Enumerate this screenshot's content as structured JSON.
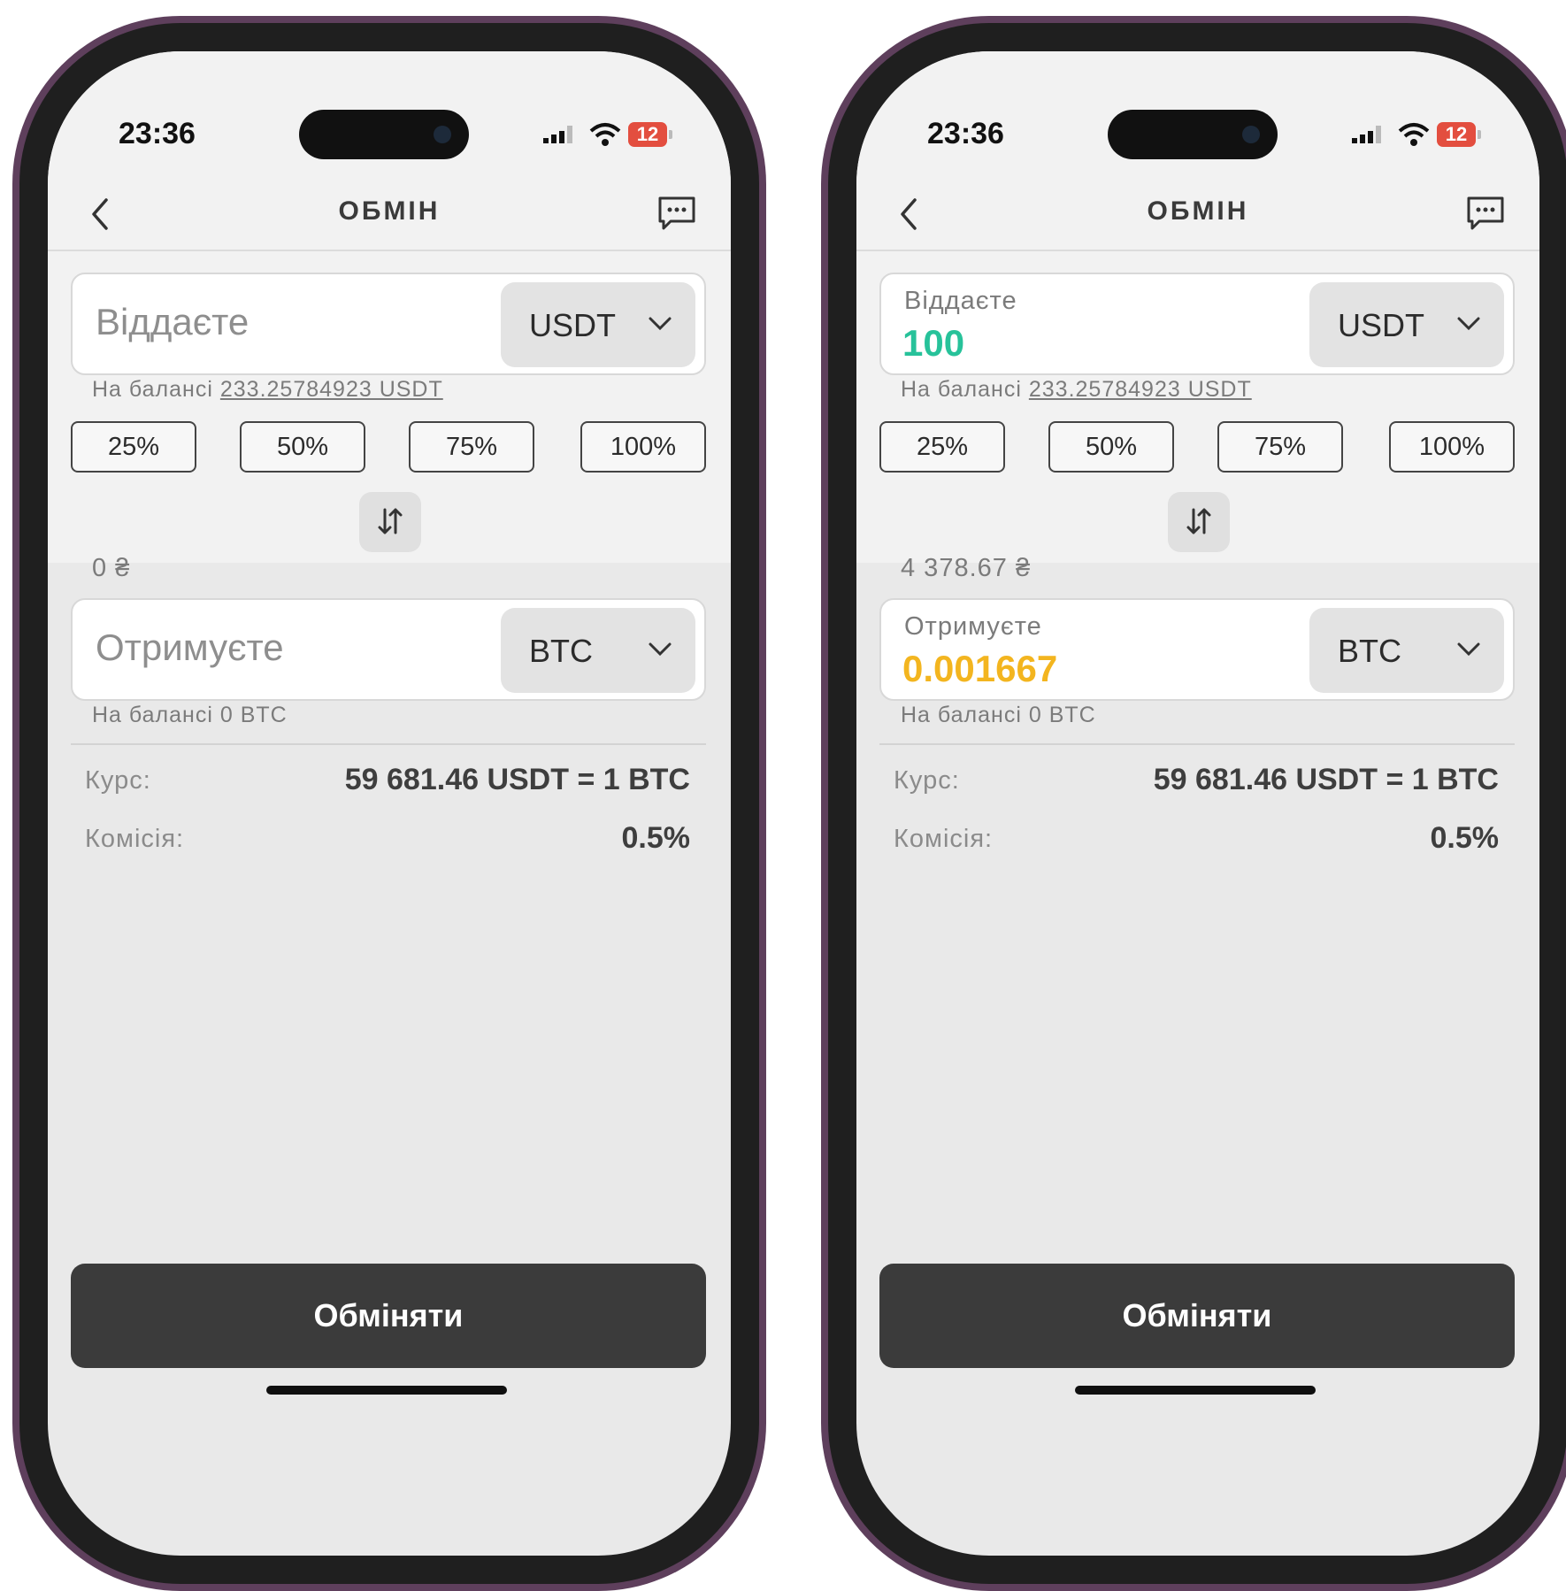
{
  "screens": [
    {
      "status": {
        "time": "23:36",
        "battery": "12"
      },
      "header": {
        "title": "ОБМІН"
      },
      "give": {
        "placeholder": "Віддаєте",
        "label": "",
        "value": "",
        "currency": "USDT",
        "balance_prefix": "На балансі",
        "balance_value": "233.25784923 USDT"
      },
      "percent_buttons": [
        "25%",
        "50%",
        "75%",
        "100%"
      ],
      "fiat_value": "0 ₴",
      "receive": {
        "placeholder": "Отримуєте",
        "label": "",
        "value": "",
        "currency": "BTC",
        "balance_text": "На балансі 0 BTC"
      },
      "rate": {
        "label": "Курс:",
        "value": "59 681.46 USDT = 1 BTC"
      },
      "fee": {
        "label": "Комісія:",
        "value": "0.5%"
      },
      "exchange_button": "Обміняти"
    },
    {
      "status": {
        "time": "23:36",
        "battery": "12"
      },
      "header": {
        "title": "ОБМІН"
      },
      "give": {
        "placeholder": "",
        "label": "Віддаєте",
        "value": "100",
        "currency": "USDT",
        "balance_prefix": "На балансі",
        "balance_value": "233.25784923 USDT"
      },
      "percent_buttons": [
        "25%",
        "50%",
        "75%",
        "100%"
      ],
      "fiat_value": "4 378.67 ₴",
      "receive": {
        "placeholder": "",
        "label": "Отримуєте",
        "value": "0.001667",
        "currency": "BTC",
        "balance_text": "На балансі 0 BTC"
      },
      "rate": {
        "label": "Курс:",
        "value": "59 681.46 USDT = 1 BTC"
      },
      "fee": {
        "label": "Комісія:",
        "value": "0.5%"
      },
      "exchange_button": "Обміняти"
    }
  ],
  "colors": {
    "accent_green": "#27c29a",
    "accent_yellow": "#f3b51f",
    "phone_frame": "#5e3f5c",
    "button_dark": "#3b3b3b"
  },
  "icons": [
    "back-chevron-icon",
    "chat-icon",
    "signal-icon",
    "wifi-icon",
    "battery-icon",
    "swap-arrows-icon",
    "chevron-down-icon"
  ]
}
